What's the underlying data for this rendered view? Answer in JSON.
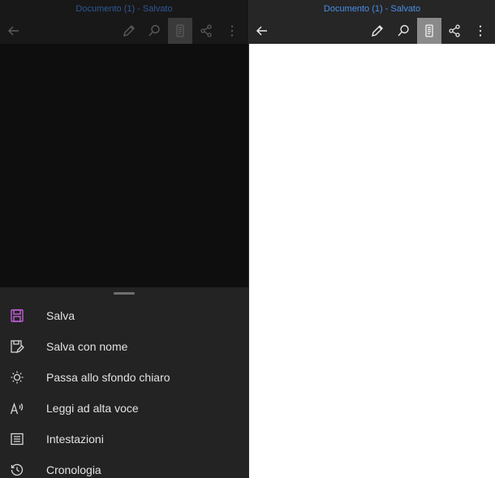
{
  "left": {
    "window_title": "Documento (1) - Salvato",
    "toolbar": {
      "back_icon": "back-arrow-icon",
      "edit_icon": "pencil-icon",
      "search_icon": "search-icon",
      "reading_mode_icon": "reading-mode-icon",
      "share_icon": "share-icon",
      "more_icon": "more-vertical-icon"
    },
    "menu": [
      {
        "label": "Salva",
        "icon": "save-icon",
        "icon_color": "#c45fd8"
      },
      {
        "label": "Salva con nome",
        "icon": "save-as-icon",
        "icon_color": "#d8d8d8"
      },
      {
        "label": "Passa allo sfondo chiaro",
        "icon": "sun-icon",
        "icon_color": "#d8d8d8"
      },
      {
        "label": "Leggi ad alta voce",
        "icon": "read-aloud-icon",
        "icon_color": "#d8d8d8"
      },
      {
        "label": "Intestazioni",
        "icon": "headings-icon",
        "icon_color": "#d8d8d8"
      },
      {
        "label": "Cronologia",
        "icon": "history-icon",
        "icon_color": "#d8d8d8"
      }
    ]
  },
  "right": {
    "window_title": "Documento (1) - Salvato",
    "toolbar": {
      "back_icon": "back-arrow-icon",
      "edit_icon": "pencil-icon",
      "search_icon": "search-icon",
      "reading_mode_icon": "reading-mode-icon",
      "share_icon": "share-icon",
      "more_icon": "more-vertical-icon"
    }
  },
  "colors": {
    "title_blue": "#4a8ee8",
    "save_accent": "#c45fd8",
    "page_background": "#ffffff"
  }
}
